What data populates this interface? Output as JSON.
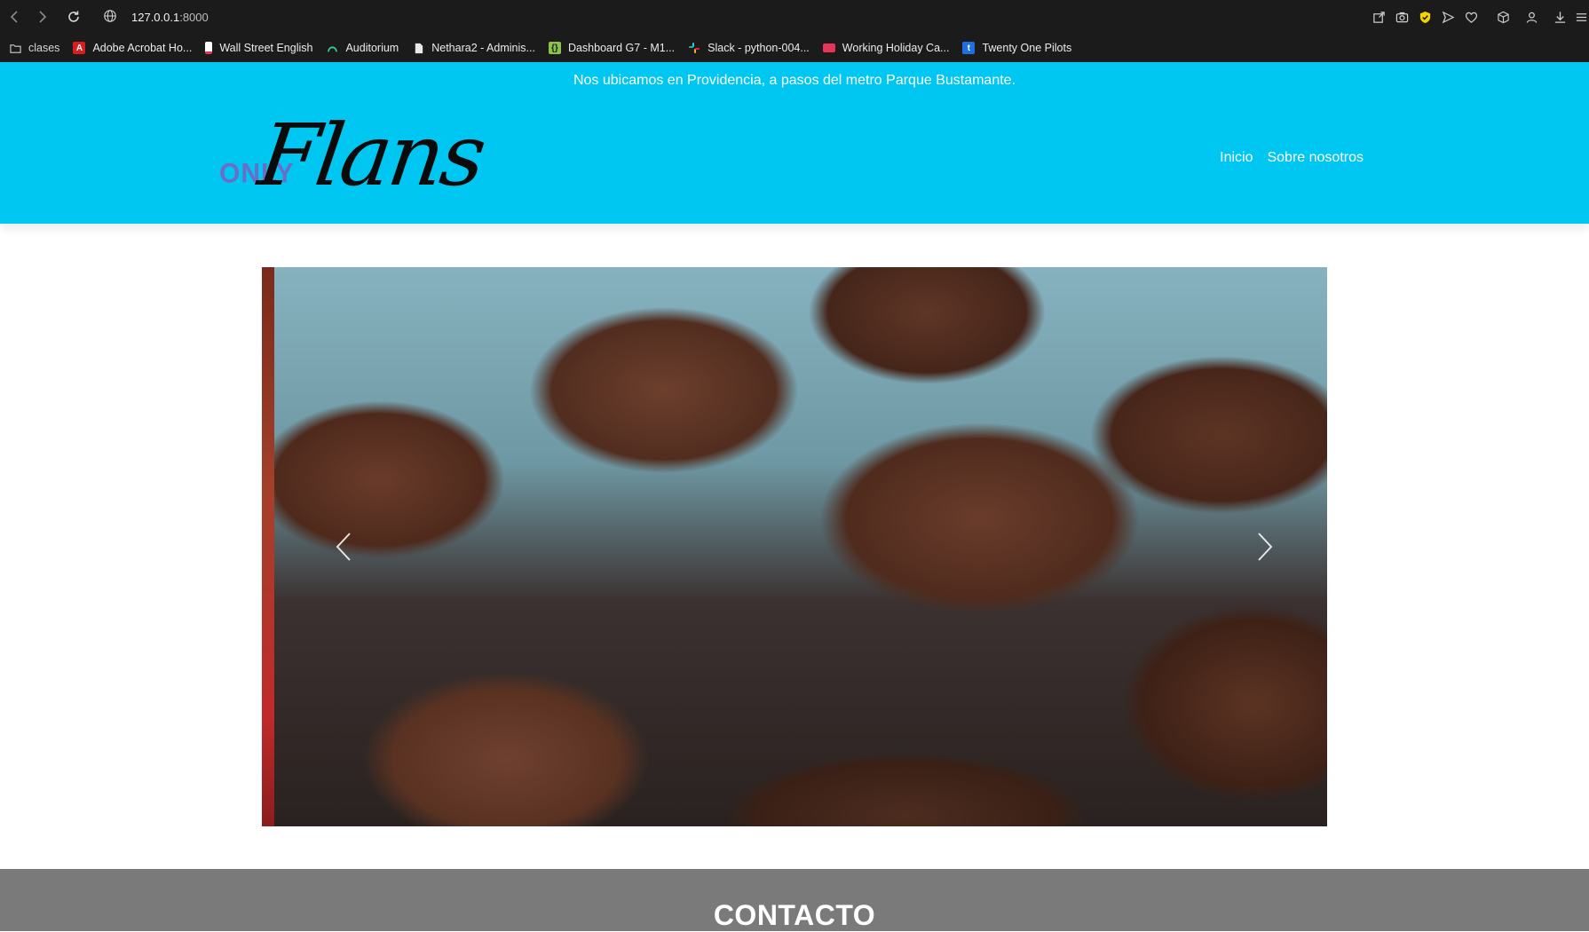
{
  "browser": {
    "url_host": "127.0.0.1",
    "url_port": ":8000",
    "bookmarks": [
      {
        "label": "clases",
        "icon": "folder-icon",
        "color": "#cfcfcf"
      },
      {
        "label": "Adobe Acrobat Ho...",
        "icon": "acrobat-icon",
        "color": "#d81e1e"
      },
      {
        "label": "Wall Street English",
        "icon": "wse-icon",
        "color": "#e8e8e8"
      },
      {
        "label": "Auditorium",
        "icon": "auditorium-icon",
        "color": "#2bd19a"
      },
      {
        "label": "Nethara2 - Adminis...",
        "icon": "document-icon",
        "color": "#e8e8e8"
      },
      {
        "label": "Dashboard G7 - M1...",
        "icon": "dashboard-icon",
        "color": "#8bc34a"
      },
      {
        "label": "Slack - python-004...",
        "icon": "slack-icon",
        "color": "#e01e5a"
      },
      {
        "label": "Working Holiday Ca...",
        "icon": "flag-icon",
        "color": "#e8345a"
      },
      {
        "label": "Twenty One Pilots",
        "icon": "tumblr-icon",
        "color": "#1f6fe0"
      }
    ]
  },
  "site": {
    "announcement": "Nos ubicamos en Providencia, a pasos del metro Parque Bustamante.",
    "logo": {
      "small": "ONLY",
      "big": "Flans"
    },
    "nav": [
      {
        "label": "Inicio"
      },
      {
        "label": "Sobre nosotros"
      }
    ],
    "carousel": {
      "current_slide": "chocolate muffins"
    },
    "contact_heading": "CONTACTO"
  },
  "colors": {
    "brand_cyan": "#00c7f2",
    "contact_gray": "#7a7a7a"
  }
}
